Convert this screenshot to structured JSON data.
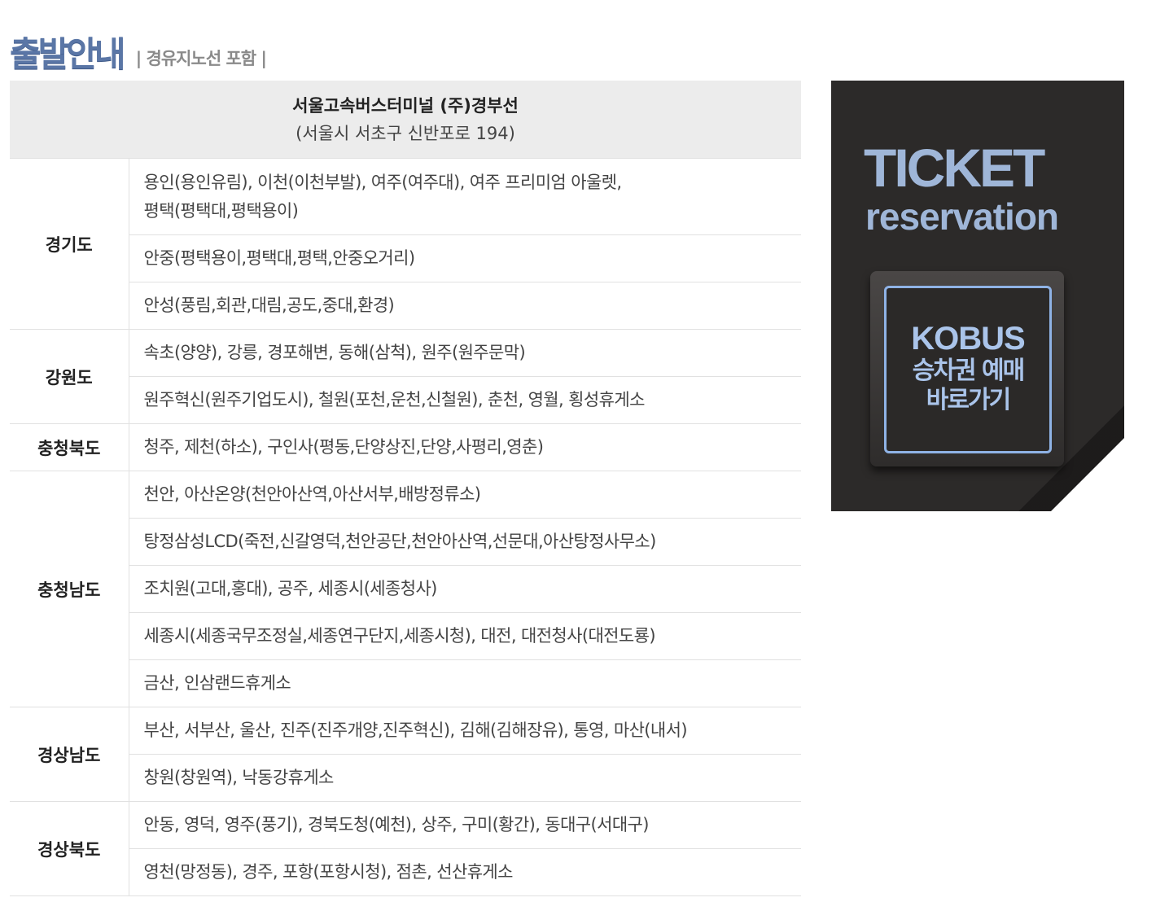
{
  "heading": {
    "title": "출발안내",
    "subtitle": "| 경유지노선 포함 |"
  },
  "terminal": {
    "name": "서울고속버스터미널 (주)경부선",
    "address": "(서울시 서초구 신반포로 194)"
  },
  "regions": [
    {
      "name": "경기도",
      "routes": [
        [
          "용인(용인유림), 이천(이천부발), 여주(여주대), 여주 프리미엄 아울렛,",
          "평택(평택대,평택용이)"
        ],
        [
          "안중(평택용이,평택대,평택,안중오거리)"
        ],
        [
          "안성(풍림,회관,대림,공도,중대,환경)"
        ]
      ]
    },
    {
      "name": "강원도",
      "routes": [
        [
          "속초(양양), 강릉, 경포해변, 동해(삼척), 원주(원주문막)"
        ],
        [
          "원주혁신(원주기업도시), 철원(포천,운천,신철원), 춘천, 영월, 횡성휴게소"
        ]
      ]
    },
    {
      "name": "충청북도",
      "routes": [
        [
          "청주, 제천(하소), 구인사(평동,단양상진,단양,사평리,영춘)"
        ]
      ]
    },
    {
      "name": "충청남도",
      "routes": [
        [
          "천안, 아산온양(천안아산역,아산서부,배방정류소)"
        ],
        [
          "탕정삼성LCD(죽전,신갈영덕,천안공단,천안아산역,선문대,아산탕정사무소)"
        ],
        [
          "조치원(고대,홍대), 공주, 세종시(세종청사)"
        ],
        [
          "세종시(세종국무조정실,세종연구단지,세종시청), 대전, 대전청사(대전도룡)"
        ],
        [
          "금산, 인삼랜드휴게소"
        ]
      ]
    },
    {
      "name": "경상남도",
      "routes": [
        [
          "부산, 서부산, 울산, 진주(진주개양,진주혁신), 김해(김해장유), 통영, 마산(내서)"
        ],
        [
          "창원(창원역), 낙동강휴게소"
        ]
      ]
    },
    {
      "name": "경상북도",
      "routes": [
        [
          "안동, 영덕, 영주(풍기), 경북도청(예천), 상주, 구미(황간), 동대구(서대구)"
        ],
        [
          "영천(망정동), 경주, 포항(포항시청), 점촌, 선산휴게소"
        ]
      ]
    }
  ],
  "banner": {
    "title": "TICKET",
    "subtitle": "reservation",
    "button_brand": "KOBUS",
    "button_line1": "승차권 예매",
    "button_line2": "바로가기",
    "colors": {
      "background": "#2c2a29",
      "accent": "#9fb6d8",
      "heading": "#5a76a6"
    }
  }
}
